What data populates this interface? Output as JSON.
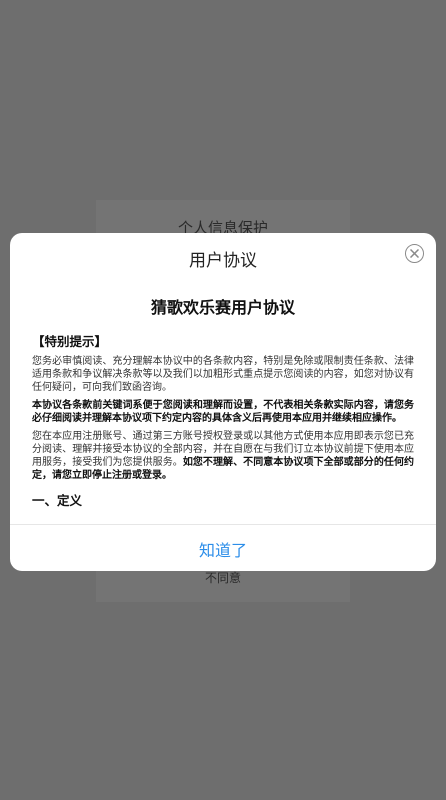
{
  "background_dialog": {
    "title": "个人信息保护",
    "disagree_label": "不同意"
  },
  "modal": {
    "title": "用户协议",
    "close_icon": "close-circle-icon",
    "doc_title": "猜歌欢乐赛用户协议",
    "special_notice_heading": "【特别提示】",
    "para1": "您务必审慎阅读、充分理解本协议中的各条款内容，特别是免除或限制责任条款、法律适用条款和争议解决条款等以及我们以加粗形式重点提示您阅读的内容，如您对协议有任何疑问，可向我们致函咨询。",
    "para2": "本协议各条款前关键词系便于您阅读和理解而设置，不代表相关条款实际内容，请您务必仔细阅读并理解本协议项下约定内容的具体含义后再使用本应用并继续相应操作。",
    "para3_normal": "您在本应用注册账号、通过第三方账号授权登录或以其他方式使用本应用即表示您已充分阅读、理解并接受本协议的全部内容，并在自愿在与我们订立本协议前提下使用本应用服务，接受我们为您提供服务。",
    "para3_bold": "如您不理解、不同意本协议项下全部或部分的任何约定，请您立即停止注册或登录。",
    "definitions_heading": "一、定义",
    "ok_label": "知道了"
  },
  "colors": {
    "overlay": "#6e6e6e",
    "accent": "#2b8de9"
  }
}
